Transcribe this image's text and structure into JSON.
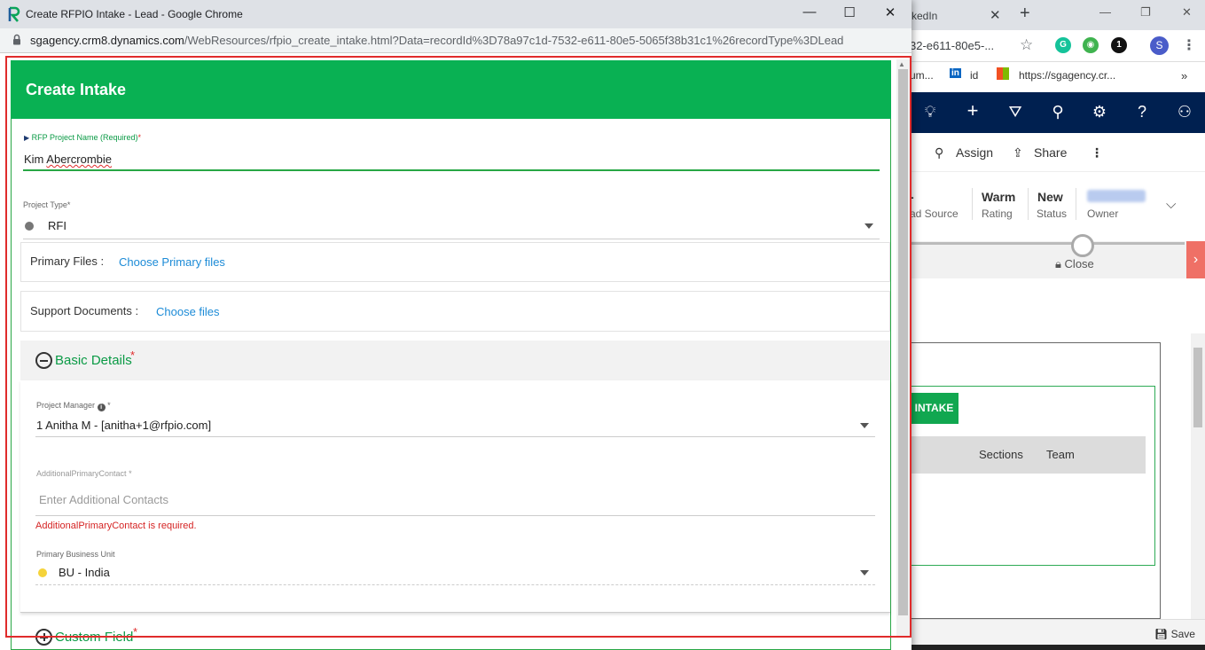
{
  "popup": {
    "window_title": "Create RFPIO Intake - Lead - Google Chrome",
    "url_host": "sgagency.crm8.dynamics.com",
    "url_path": "/WebResources/rfpio_create_intake.html?Data=recordId%3D78a97c1d-7532-e611-80e5-5065f38b31c1%26recordType%3DLead"
  },
  "modal": {
    "title": "Create Intake",
    "rfp_name": {
      "label": "RFP Project Name (Required)",
      "required_mark": "*",
      "value_first": "Kim",
      "value_last": "Abercrombie"
    },
    "project_type": {
      "label": "Project Type",
      "required_mark": "*",
      "value": "RFI",
      "dot_color": "#777777"
    },
    "primary_files": {
      "label": "Primary Files :",
      "link": "Choose Primary files"
    },
    "support_documents": {
      "label": "Support Documents :",
      "link": "Choose files"
    },
    "basic_details": {
      "title": "Basic Details",
      "required_mark": "*",
      "project_manager": {
        "label": "Project Manager",
        "info_icon": "i",
        "required_mark": "*",
        "value": "1 Anitha M - [anitha+1@rfpio.com]"
      },
      "additional_contact": {
        "label": "AdditionalPrimaryContact",
        "required_mark": "*",
        "placeholder": "Enter Additional Contacts",
        "error": "AdditionalPrimaryContact is required."
      },
      "business_unit": {
        "label": "Primary Business Unit",
        "value": "BU - India",
        "dot_color": "#f5d33a"
      }
    },
    "custom_field": {
      "title": "Custom Field",
      "required_mark": "*"
    }
  },
  "background": {
    "tab_title": "kedIn",
    "url_fragment": "32-e611-80e5-...",
    "bookmarks": [
      "um...",
      "id",
      "https://sgagency.cr..."
    ],
    "commands": {
      "assign": "Assign",
      "share": "Share"
    },
    "header": {
      "lead_source_label": "ad Source",
      "rating_value": "Warm",
      "rating_label": "Rating",
      "status_value": "New",
      "status_label": "Status",
      "owner_label": "Owner"
    },
    "bpf_stage": "Close",
    "intake_button": "INTAKE",
    "tabs": [
      "Sections",
      "Team"
    ],
    "save": "Save",
    "avatar_letter": "S",
    "ext_badge": "1"
  }
}
